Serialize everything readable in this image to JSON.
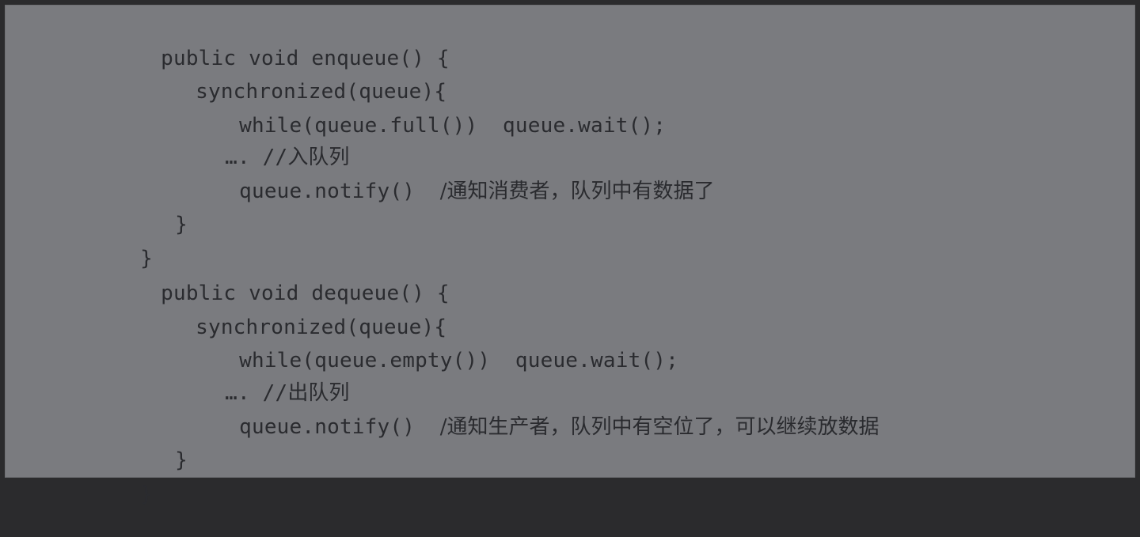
{
  "code": {
    "lines": [
      {
        "code": "public void enqueue() {",
        "comment": ""
      },
      {
        "code": "synchronized(queue){",
        "comment": ""
      },
      {
        "code": "while(queue.full())  queue.wait();",
        "comment": ""
      },
      {
        "code": "…. //",
        "comment": "入队列"
      },
      {
        "code": "queue.notify()  ",
        "comment": "/通知消费者，队列中有数据了"
      },
      {
        "code": "}",
        "comment": ""
      },
      {
        "code": "}",
        "comment": ""
      },
      {
        "code": "public void dequeue() {",
        "comment": ""
      },
      {
        "code": "synchronized(queue){",
        "comment": ""
      },
      {
        "code": "while(queue.empty())  queue.wait();",
        "comment": ""
      },
      {
        "code": "…. //",
        "comment": "出队列"
      },
      {
        "code": "queue.notify()  ",
        "comment": "/通知生产者，队列中有空位了，可以继续放数据"
      },
      {
        "code": "}",
        "comment": ""
      },
      {
        "code": "}",
        "comment": ""
      }
    ]
  },
  "colors": {
    "background": "#2b2b2d",
    "panel": "#7a7b7f",
    "text": "#2a2b2f"
  }
}
